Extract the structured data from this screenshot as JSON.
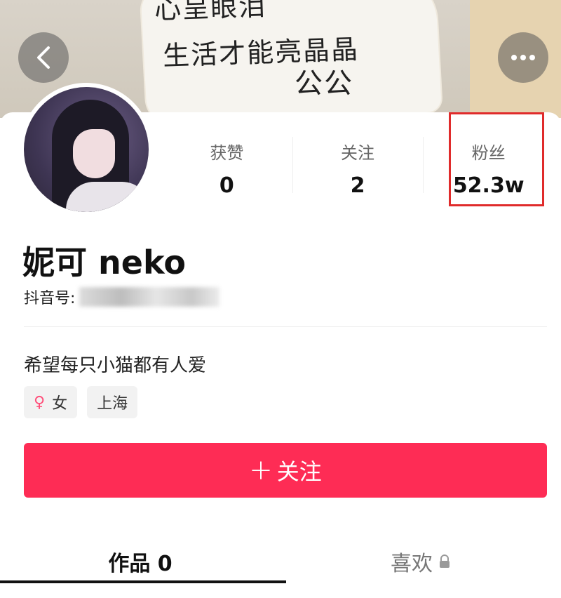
{
  "cover": {
    "line1": "心呈眼泪",
    "line2": "生活才能亮晶晶",
    "line3": "公公"
  },
  "stats": [
    {
      "label": "获赞",
      "value": "0"
    },
    {
      "label": "关注",
      "value": "2"
    },
    {
      "label": "粉丝",
      "value": "52.3w"
    }
  ],
  "profile": {
    "name": "妮可 neko",
    "account_label": "抖音号:",
    "bio": "希望每只小猫都有人爱",
    "tags": {
      "gender": "女",
      "location": "上海"
    }
  },
  "follow_button": {
    "plus": "+",
    "label": "关注"
  },
  "tabs": {
    "works": "作品 0",
    "likes": "喜欢"
  },
  "colors": {
    "accent": "#fe2c55",
    "highlight_box": "#e02b2b",
    "gender_icon": "#ff4f7a"
  }
}
